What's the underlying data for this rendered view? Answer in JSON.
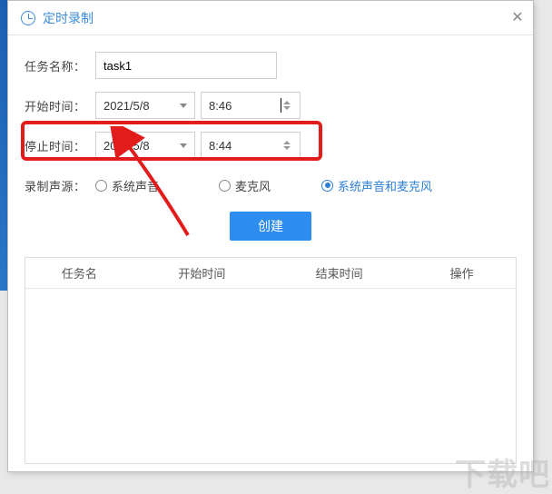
{
  "title": "定时录制",
  "labels": {
    "taskName": "任务名称：",
    "startTime": "开始时间：",
    "stopTime": "停止时间：",
    "audioSource": "录制声源："
  },
  "fields": {
    "taskName": "task1",
    "startDate": "2021/5/8",
    "startTime": "8:46",
    "stopDate": "2021/5/8",
    "stopTime": "8:44"
  },
  "audioOptions": {
    "system": "系统声音",
    "mic": "麦克风",
    "both": "系统声音和麦克风"
  },
  "createButton": "创建",
  "tableHeaders": {
    "name": "任务名",
    "start": "开始时间",
    "end": "结束时间",
    "action": "操作"
  },
  "watermark": "下载吧"
}
